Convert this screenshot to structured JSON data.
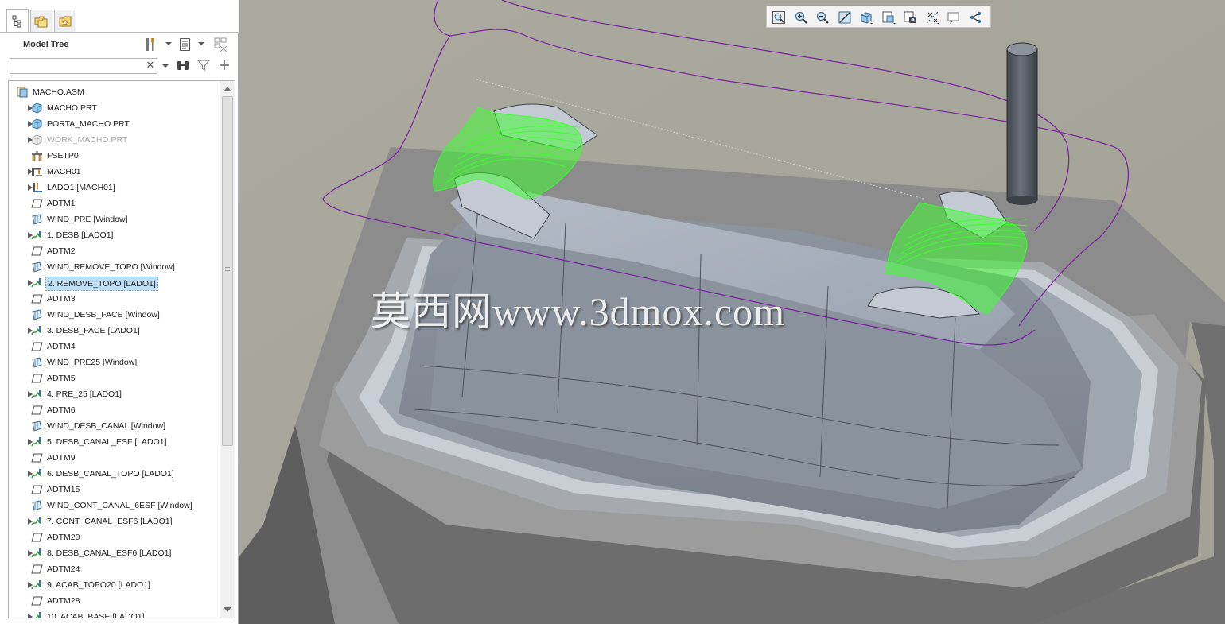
{
  "panel": {
    "tabs": [
      {
        "name": "model-tree-tab",
        "icon": "model-tree-icon",
        "active": true
      },
      {
        "name": "folder-browser-tab",
        "icon": "folder-browser-icon",
        "active": false
      },
      {
        "name": "favorites-tab",
        "icon": "favorites-icon",
        "active": false
      }
    ],
    "tree_title": "Model Tree",
    "search_placeholder": "",
    "search_value": ""
  },
  "tree": [
    {
      "label": "MACHO.ASM",
      "icon": "assembly-icon",
      "level": 0,
      "expandable": false,
      "selected": false,
      "dim": false
    },
    {
      "label": "MACHO.PRT",
      "icon": "part-icon",
      "level": 1,
      "expandable": true,
      "selected": false,
      "dim": false
    },
    {
      "label": "PORTA_MACHO.PRT",
      "icon": "part-icon",
      "level": 1,
      "expandable": true,
      "selected": false,
      "dim": false
    },
    {
      "label": "WORK_MACHO.PRT",
      "icon": "workpiece-icon",
      "level": 1,
      "expandable": true,
      "selected": false,
      "dim": true
    },
    {
      "label": "FSETP0",
      "icon": "fixture-setup-icon",
      "level": 1,
      "expandable": false,
      "selected": false,
      "dim": false
    },
    {
      "label": "MACH01",
      "icon": "machine-icon",
      "level": 1,
      "expandable": true,
      "selected": false,
      "dim": false
    },
    {
      "label": "LADO1 [MACH01]",
      "icon": "operation-icon",
      "level": 1,
      "expandable": true,
      "selected": false,
      "dim": false
    },
    {
      "label": "ADTM1",
      "icon": "datum-plane-icon",
      "level": 1,
      "expandable": false,
      "selected": false,
      "dim": false
    },
    {
      "label": "WIND_PRE [Window]",
      "icon": "window-icon",
      "level": 1,
      "expandable": false,
      "selected": false,
      "dim": false
    },
    {
      "label": "1. DESB [LADO1]",
      "icon": "toolpath-icon",
      "level": 1,
      "expandable": true,
      "selected": false,
      "dim": false
    },
    {
      "label": "ADTM2",
      "icon": "datum-plane-icon",
      "level": 1,
      "expandable": false,
      "selected": false,
      "dim": false
    },
    {
      "label": "WIND_REMOVE_TOPO [Window]",
      "icon": "window-icon",
      "level": 1,
      "expandable": false,
      "selected": false,
      "dim": false
    },
    {
      "label": "2. REMOVE_TOPO [LADO1]",
      "icon": "toolpath-icon",
      "level": 1,
      "expandable": true,
      "selected": true,
      "dim": false
    },
    {
      "label": "ADTM3",
      "icon": "datum-plane-icon",
      "level": 1,
      "expandable": false,
      "selected": false,
      "dim": false
    },
    {
      "label": "WIND_DESB_FACE [Window]",
      "icon": "window-icon",
      "level": 1,
      "expandable": false,
      "selected": false,
      "dim": false
    },
    {
      "label": "3. DESB_FACE [LADO1]",
      "icon": "toolpath-icon",
      "level": 1,
      "expandable": true,
      "selected": false,
      "dim": false
    },
    {
      "label": "ADTM4",
      "icon": "datum-plane-icon",
      "level": 1,
      "expandable": false,
      "selected": false,
      "dim": false
    },
    {
      "label": "WIND_PRE25 [Window]",
      "icon": "window-icon",
      "level": 1,
      "expandable": false,
      "selected": false,
      "dim": false
    },
    {
      "label": "ADTM5",
      "icon": "datum-plane-icon",
      "level": 1,
      "expandable": false,
      "selected": false,
      "dim": false
    },
    {
      "label": "4. PRE_25 [LADO1]",
      "icon": "toolpath-icon",
      "level": 1,
      "expandable": true,
      "selected": false,
      "dim": false
    },
    {
      "label": "ADTM6",
      "icon": "datum-plane-icon",
      "level": 1,
      "expandable": false,
      "selected": false,
      "dim": false
    },
    {
      "label": "WIND_DESB_CANAL [Window]",
      "icon": "window-icon",
      "level": 1,
      "expandable": false,
      "selected": false,
      "dim": false
    },
    {
      "label": "5. DESB_CANAL_ESF [LADO1]",
      "icon": "toolpath-icon",
      "level": 1,
      "expandable": true,
      "selected": false,
      "dim": false
    },
    {
      "label": "ADTM9",
      "icon": "datum-plane-icon",
      "level": 1,
      "expandable": false,
      "selected": false,
      "dim": false
    },
    {
      "label": "6. DESB_CANAL_TOPO [LADO1]",
      "icon": "toolpath-icon",
      "level": 1,
      "expandable": true,
      "selected": false,
      "dim": false
    },
    {
      "label": "ADTM15",
      "icon": "datum-plane-icon",
      "level": 1,
      "expandable": false,
      "selected": false,
      "dim": false
    },
    {
      "label": "WIND_CONT_CANAL_6ESF [Window]",
      "icon": "window-icon",
      "level": 1,
      "expandable": false,
      "selected": false,
      "dim": false
    },
    {
      "label": "7. CONT_CANAL_ESF6 [LADO1]",
      "icon": "toolpath-icon",
      "level": 1,
      "expandable": true,
      "selected": false,
      "dim": false
    },
    {
      "label": "ADTM20",
      "icon": "datum-plane-icon",
      "level": 1,
      "expandable": false,
      "selected": false,
      "dim": false
    },
    {
      "label": "8. DESB_CANAL_ESF6 [LADO1]",
      "icon": "toolpath-icon",
      "level": 1,
      "expandable": true,
      "selected": false,
      "dim": false
    },
    {
      "label": "ADTM24",
      "icon": "datum-plane-icon",
      "level": 1,
      "expandable": false,
      "selected": false,
      "dim": false
    },
    {
      "label": "9. ACAB_TOPO20 [LADO1]",
      "icon": "toolpath-icon",
      "level": 1,
      "expandable": true,
      "selected": false,
      "dim": false
    },
    {
      "label": "ADTM28",
      "icon": "datum-plane-icon",
      "level": 1,
      "expandable": false,
      "selected": false,
      "dim": false
    },
    {
      "label": "10. ACAB_BASE [LADO1]",
      "icon": "toolpath-icon",
      "level": 1,
      "expandable": true,
      "selected": false,
      "dim": false
    }
  ],
  "view_toolbar": [
    "refit-icon",
    "zoom-in-icon",
    "zoom-out-icon",
    "repaint-icon",
    "display-style-icon",
    "saved-views-icon",
    "view-manager-icon",
    "datum-display-icon",
    "annotation-display-icon",
    "spin-center-icon"
  ],
  "watermark": "莫西网www.3dmox.com",
  "colors": {
    "background": "#a5a397",
    "toolpath": "#3dff2e",
    "boundary": "#7a1fa0",
    "selection": "#bfe0f7"
  }
}
